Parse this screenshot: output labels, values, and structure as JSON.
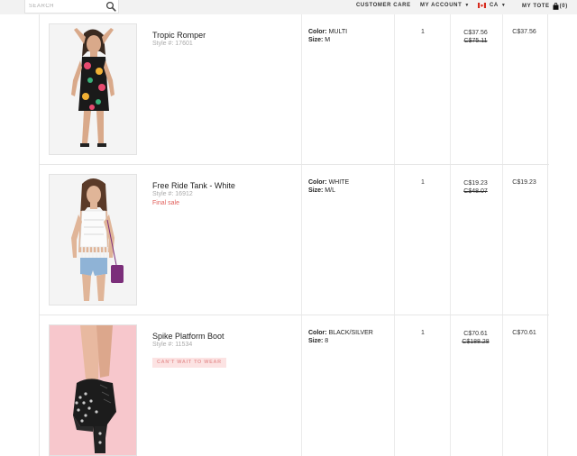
{
  "header": {
    "search_placeholder": "SEARCH",
    "customer_care": "CUSTOMER CARE",
    "my_account": "MY ACCOUNT",
    "country": "CA",
    "my_tote": "MY TOTE",
    "tote_count": "(0)"
  },
  "labels": {
    "color": "Color:",
    "size": "Size:"
  },
  "items": [
    {
      "name": "Tropic Romper",
      "style": "Style #: 17601",
      "color": "MULTI",
      "size": "M",
      "qty": "1",
      "sale_price": "C$37.56",
      "original_price": "C$75.11",
      "total": "C$37.56"
    },
    {
      "name": "Free Ride Tank - White",
      "style": "Style #: 16912",
      "final_sale": "Final sale",
      "color": "WHITE",
      "size": "M/L",
      "qty": "1",
      "sale_price": "C$19.23",
      "original_price": "C$48.07",
      "total": "C$19.23"
    },
    {
      "name": "Spike Platform Boot",
      "style": "Style #: 11534",
      "badge": "CAN'T WAIT TO WEAR",
      "color": "BLACK/SILVER",
      "size": "8",
      "qty": "1",
      "sale_price": "C$70.61",
      "original_price": "C$188.28",
      "total": "C$70.61"
    }
  ]
}
